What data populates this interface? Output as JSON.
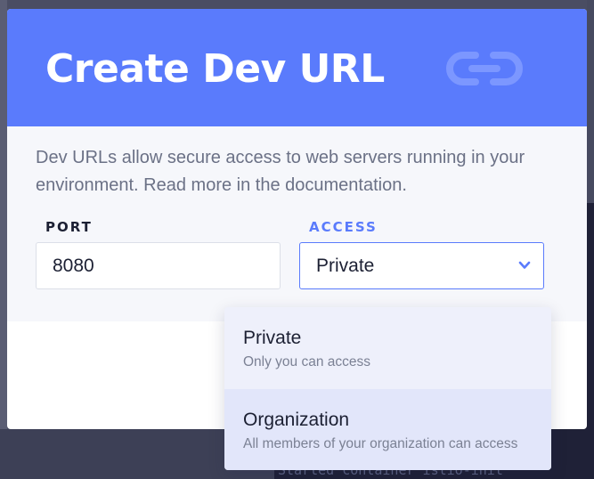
{
  "modal": {
    "title": "Create Dev URL",
    "description": "Dev URLs allow secure access to web servers running in your environment. Read more in the documentation.",
    "header_icon": "link-icon",
    "accent_color": "#5a7bfc"
  },
  "form": {
    "port": {
      "label": "PORT",
      "value": "8080"
    },
    "access": {
      "label": "ACCESS",
      "selected": "Private",
      "icon": "chevron-down-icon"
    }
  },
  "dropdown": {
    "options": [
      {
        "title": "Private",
        "subtitle": "Only you can access"
      },
      {
        "title": "Organization",
        "subtitle": "All members of your organization can access"
      }
    ]
  },
  "background": {
    "terminal_line": "Started container istio-init"
  }
}
